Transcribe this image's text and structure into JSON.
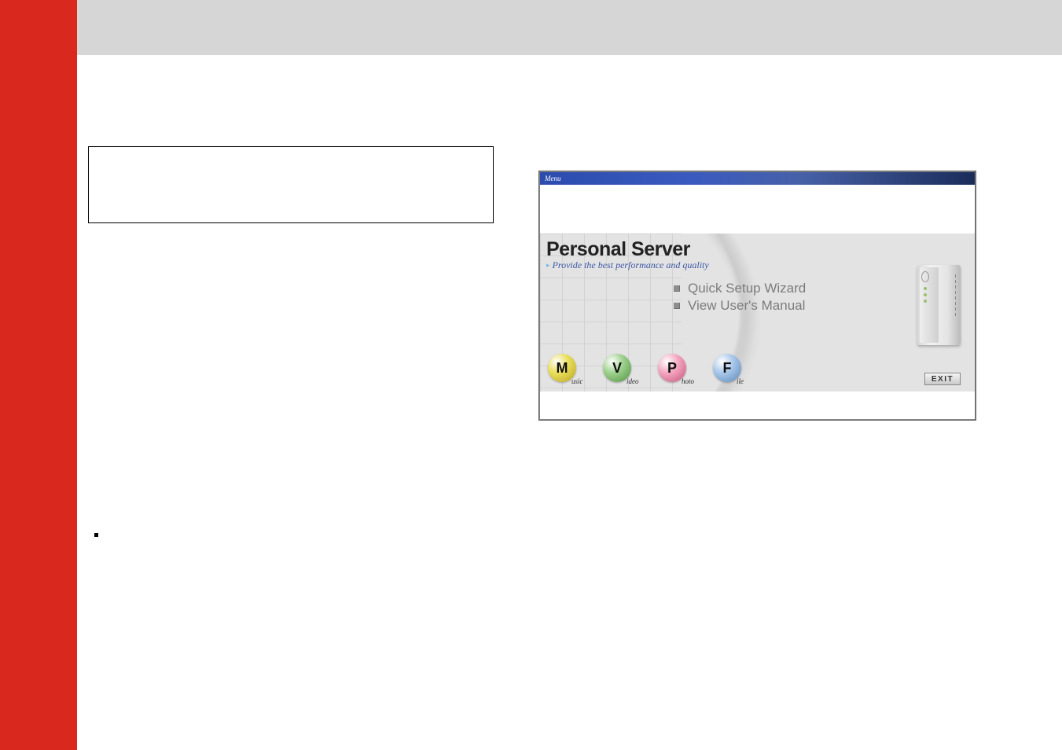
{
  "screenshot": {
    "menu_label": "Menu",
    "title": "Personal Server",
    "subtitle": "Provide the best performance and quality",
    "links": {
      "quick_setup": "Quick Setup Wizard",
      "view_manual": "View User's Manual"
    },
    "badges": {
      "music": {
        "letter": "M",
        "sub": "usic"
      },
      "video": {
        "letter": "V",
        "sub": "ideo"
      },
      "photo": {
        "letter": "P",
        "sub": "hoto"
      },
      "file": {
        "letter": "F",
        "sub": "ile"
      }
    },
    "exit_label": "EXIT"
  }
}
